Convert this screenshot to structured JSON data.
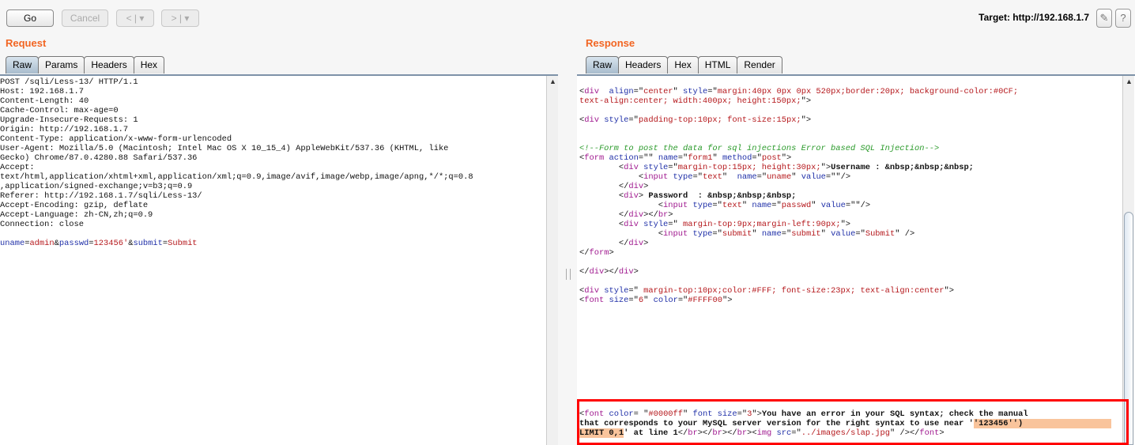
{
  "toolbar": {
    "go": "Go",
    "cancel": "Cancel",
    "back": "< | ▾",
    "forward": "> | ▾",
    "target": "Target: http://192.168.1.7",
    "edit_icon": "pencil-icon",
    "help": "?"
  },
  "request": {
    "title": "Request",
    "tabs": [
      "Raw",
      "Params",
      "Headers",
      "Hex"
    ],
    "active_tab": "Raw",
    "lines": [
      [
        [
          "t",
          "POST /sqli/Less-13/ HTTP/1.1"
        ]
      ],
      [
        [
          "t",
          "Host: 192.168.1.7"
        ]
      ],
      [
        [
          "t",
          "Content-Length: 40"
        ]
      ],
      [
        [
          "t",
          "Cache-Control: max-age=0"
        ]
      ],
      [
        [
          "t",
          "Upgrade-Insecure-Requests: 1"
        ]
      ],
      [
        [
          "t",
          "Origin: http://192.168.1.7"
        ]
      ],
      [
        [
          "t",
          "Content-Type: application/x-www-form-urlencoded"
        ]
      ],
      [
        [
          "t",
          "User-Agent: Mozilla/5.0 (Macintosh; Intel Mac OS X 10_15_4) AppleWebKit/537.36 (KHTML, like"
        ]
      ],
      [
        [
          "t",
          "Gecko) Chrome/87.0.4280.88 Safari/537.36"
        ]
      ],
      [
        [
          "t",
          "Accept:"
        ]
      ],
      [
        [
          "t",
          "text/html,application/xhtml+xml,application/xml;q=0.9,image/avif,image/webp,image/apng,*/*;q=0.8"
        ]
      ],
      [
        [
          "t",
          ",application/signed-exchange;v=b3;q=0.9"
        ]
      ],
      [
        [
          "t",
          "Referer: http://192.168.1.7/sqli/Less-13/"
        ]
      ],
      [
        [
          "t",
          "Accept-Encoding: gzip, deflate"
        ]
      ],
      [
        [
          "t",
          "Accept-Language: zh-CN,zh;q=0.9"
        ]
      ],
      [
        [
          "t",
          "Connection: close"
        ]
      ],
      [],
      [
        [
          "pname",
          "uname"
        ],
        [
          "t",
          "="
        ],
        [
          "pval",
          "admin"
        ],
        [
          "t",
          "&"
        ],
        [
          "pname",
          "passwd"
        ],
        [
          "t",
          "="
        ],
        [
          "pval",
          "123456'"
        ],
        [
          "t",
          "&"
        ],
        [
          "pname",
          "submit"
        ],
        [
          "t",
          "="
        ],
        [
          "pval",
          "Submit"
        ]
      ]
    ]
  },
  "response": {
    "title": "Response",
    "tabs": [
      "Raw",
      "Headers",
      "Hex",
      "HTML",
      "Render"
    ],
    "active_tab": "Raw",
    "lines": [
      [
        [
          "t",
          "<"
        ],
        [
          "tag",
          "div"
        ],
        [
          "t",
          "  "
        ],
        [
          "attr",
          "align"
        ],
        [
          "t",
          "=\""
        ],
        [
          "val",
          "center"
        ],
        [
          "t",
          "\" "
        ],
        [
          "attr",
          "style"
        ],
        [
          "t",
          "=\""
        ],
        [
          "val",
          "margin:40px 0px 0px 520px;border:20px; background-color:#0CF;"
        ]
      ],
      [
        [
          "val",
          "text-align:center; width:400px; height:150px;"
        ],
        [
          "t",
          "\">"
        ]
      ],
      [],
      [
        [
          "t",
          "<"
        ],
        [
          "tag",
          "div"
        ],
        [
          "t",
          " "
        ],
        [
          "attr",
          "style"
        ],
        [
          "t",
          "=\""
        ],
        [
          "val",
          "padding-top:10px; font-size:15px;"
        ],
        [
          "t",
          "\">"
        ]
      ],
      [],
      [],
      [
        [
          "com",
          "<!--Form to post the data for sql injections Error based SQL Injection-->"
        ]
      ],
      [
        [
          "t",
          "<"
        ],
        [
          "tag",
          "form"
        ],
        [
          "t",
          " "
        ],
        [
          "attr",
          "action"
        ],
        [
          "t",
          "=\"\" "
        ],
        [
          "attr",
          "name"
        ],
        [
          "t",
          "=\""
        ],
        [
          "val",
          "form1"
        ],
        [
          "t",
          "\" "
        ],
        [
          "attr",
          "method"
        ],
        [
          "t",
          "=\""
        ],
        [
          "val",
          "post"
        ],
        [
          "t",
          "\">"
        ]
      ],
      [
        [
          "t",
          "\t<"
        ],
        [
          "tag",
          "div"
        ],
        [
          "t",
          " "
        ],
        [
          "attr",
          "style"
        ],
        [
          "t",
          "=\""
        ],
        [
          "val",
          "margin-top:15px; height:30px;"
        ],
        [
          "t",
          "\">"
        ],
        [
          "b",
          "Username : &nbsp;&nbsp;&nbsp;"
        ]
      ],
      [
        [
          "t",
          "\t    <"
        ],
        [
          "tag",
          "input"
        ],
        [
          "t",
          " "
        ],
        [
          "attr",
          "type"
        ],
        [
          "t",
          "=\""
        ],
        [
          "val",
          "text"
        ],
        [
          "t",
          "\"  "
        ],
        [
          "attr",
          "name"
        ],
        [
          "t",
          "=\""
        ],
        [
          "val",
          "uname"
        ],
        [
          "t",
          "\" "
        ],
        [
          "attr",
          "value"
        ],
        [
          "t",
          "=\"\"/>"
        ]
      ],
      [
        [
          "t",
          "\t</"
        ],
        [
          "tag",
          "div"
        ],
        [
          "t",
          ">"
        ]
      ],
      [
        [
          "t",
          "\t<"
        ],
        [
          "tag",
          "div"
        ],
        [
          "t",
          "> "
        ],
        [
          "b",
          "Password  : &nbsp;&nbsp;&nbsp;"
        ]
      ],
      [
        [
          "t",
          "\t\t<"
        ],
        [
          "tag",
          "input"
        ],
        [
          "t",
          " "
        ],
        [
          "attr",
          "type"
        ],
        [
          "t",
          "=\""
        ],
        [
          "val",
          "text"
        ],
        [
          "t",
          "\" "
        ],
        [
          "attr",
          "name"
        ],
        [
          "t",
          "=\""
        ],
        [
          "val",
          "passwd"
        ],
        [
          "t",
          "\" "
        ],
        [
          "attr",
          "value"
        ],
        [
          "t",
          "=\"\"/>"
        ]
      ],
      [
        [
          "t",
          "\t</"
        ],
        [
          "tag",
          "div"
        ],
        [
          "t",
          "></"
        ],
        [
          "tag",
          "br"
        ],
        [
          "t",
          ">"
        ]
      ],
      [
        [
          "t",
          "\t<"
        ],
        [
          "tag",
          "div"
        ],
        [
          "t",
          " "
        ],
        [
          "attr",
          "style"
        ],
        [
          "t",
          "=\" "
        ],
        [
          "val",
          "margin-top:9px;margin-left:90px;"
        ],
        [
          "t",
          "\">"
        ]
      ],
      [
        [
          "t",
          "\t\t<"
        ],
        [
          "tag",
          "input"
        ],
        [
          "t",
          " "
        ],
        [
          "attr",
          "type"
        ],
        [
          "t",
          "=\""
        ],
        [
          "val",
          "submit"
        ],
        [
          "t",
          "\" "
        ],
        [
          "attr",
          "name"
        ],
        [
          "t",
          "=\""
        ],
        [
          "val",
          "submit"
        ],
        [
          "t",
          "\" "
        ],
        [
          "attr",
          "value"
        ],
        [
          "t",
          "=\""
        ],
        [
          "val",
          "Submit"
        ],
        [
          "t",
          "\" />"
        ]
      ],
      [
        [
          "t",
          "\t</"
        ],
        [
          "tag",
          "div"
        ],
        [
          "t",
          ">"
        ]
      ],
      [
        [
          "t",
          "</"
        ],
        [
          "tag",
          "form"
        ],
        [
          "t",
          ">"
        ]
      ],
      [],
      [
        [
          "t",
          "</"
        ],
        [
          "tag",
          "div"
        ],
        [
          "t",
          "></"
        ],
        [
          "tag",
          "div"
        ],
        [
          "t",
          ">"
        ]
      ],
      [],
      [
        [
          "t",
          "<"
        ],
        [
          "tag",
          "div"
        ],
        [
          "t",
          " "
        ],
        [
          "attr",
          "style"
        ],
        [
          "t",
          "=\" "
        ],
        [
          "val",
          "margin-top:10px;color:#FFF; font-size:23px; text-align:center"
        ],
        [
          "t",
          "\">"
        ]
      ],
      [
        [
          "t",
          "<"
        ],
        [
          "tag",
          "font"
        ],
        [
          "t",
          " "
        ],
        [
          "attr",
          "size"
        ],
        [
          "t",
          "=\""
        ],
        [
          "val",
          "6"
        ],
        [
          "t",
          "\" "
        ],
        [
          "attr",
          "color"
        ],
        [
          "t",
          "=\""
        ],
        [
          "val",
          "#FFFF00"
        ],
        [
          "t",
          "\">"
        ]
      ]
    ],
    "error_lines": [
      [
        [
          "t",
          "<"
        ],
        [
          "tag",
          "font"
        ],
        [
          "t",
          " "
        ],
        [
          "attr",
          "color"
        ],
        [
          "t",
          "= \""
        ],
        [
          "val",
          "#0000ff"
        ],
        [
          "t",
          "\" "
        ],
        [
          "attr",
          "font size"
        ],
        [
          "t",
          "=\""
        ],
        [
          "val",
          "3"
        ],
        [
          "t",
          "\">"
        ],
        [
          "b",
          "You have an error in your SQL syntax; check the manual"
        ]
      ],
      [
        [
          "b",
          "that corresponds to your MySQL server version for the right syntax to use near '"
        ],
        [
          "hl",
          "'123456'')                  "
        ]
      ],
      [
        [
          "hl",
          "LIMIT 0,1"
        ],
        [
          "b",
          "' at line 1"
        ],
        [
          "t",
          "</"
        ],
        [
          "tag",
          "br"
        ],
        [
          "t",
          "></"
        ],
        [
          "tag",
          "br"
        ],
        [
          "t",
          "></"
        ],
        [
          "tag",
          "br"
        ],
        [
          "t",
          "><"
        ],
        [
          "tag",
          "img"
        ],
        [
          "t",
          " "
        ],
        [
          "attr",
          "src"
        ],
        [
          "t",
          "=\""
        ],
        [
          "val",
          "../images/slap.jpg"
        ],
        [
          "t",
          "\" /></"
        ],
        [
          "tag",
          "font"
        ],
        [
          "t",
          ">"
        ]
      ]
    ]
  },
  "colors": {
    "accent": "#f26522",
    "highlight": "#f9c49c",
    "annotation_box": "#ff0000"
  }
}
